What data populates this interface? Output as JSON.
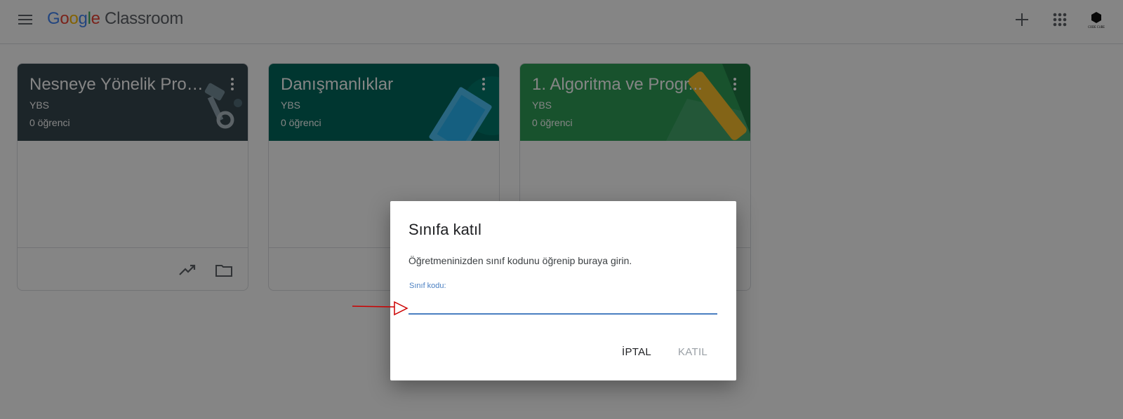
{
  "app": {
    "logo_letters": [
      "G",
      "o",
      "o",
      "g",
      "l",
      "e"
    ],
    "product": "Classroom",
    "logo_colors": [
      "#4285F4",
      "#EA4335",
      "#FBBC05",
      "#4285F4",
      "#34A853",
      "#EA4335"
    ],
    "avatar_text": "CODE CUBE"
  },
  "header_icons": {
    "menu": "menu-icon",
    "create": "plus-icon",
    "apps": "apps-grid-icon",
    "account": "avatar"
  },
  "cards": [
    {
      "title": "Nesneye Yönelik Prog...",
      "section": "YBS",
      "count": "0 öğrenci",
      "color": "#37474f"
    },
    {
      "title": "Danışmanlıklar",
      "section": "YBS",
      "count": "0 öğrenci",
      "color": "#00695c"
    },
    {
      "title": "1. Algoritma ve Progr...",
      "section": "YBS",
      "count": "0 öğrenci",
      "color": "#2e9e57"
    }
  ],
  "dialog": {
    "title": "Sınıfa katıl",
    "description": "Öğretmeninizden sınıf kodunu öğrenip buraya girin.",
    "field_label": "Sınıf kodu:",
    "field_value": "",
    "cancel_label": "İPTAL",
    "join_label": "KATIL",
    "accent": "#4a7fc1"
  },
  "annotation": {
    "color": "#cc0000"
  }
}
